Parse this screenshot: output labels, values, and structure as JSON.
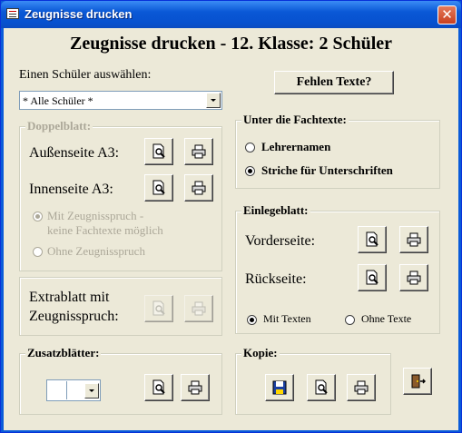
{
  "window": {
    "title": "Zeugnisse drucken",
    "close_glyph": "✕"
  },
  "heading": "Zeugnisse drucken - 12. Klasse: 2 Schüler",
  "student_select": {
    "label": "Einen Schüler auswählen:",
    "value": "* Alle Schüler *"
  },
  "missing_texts_button": "Fehlen Texte?",
  "doppelblatt": {
    "title": "Doppelblatt:",
    "aussen_label": "Außenseite A3:",
    "innen_label": "Innenseite A3:",
    "option_with_line1": "Mit Zeugnisspruch -",
    "option_with_line2": "keine Fachtexte möglich",
    "option_without": "Ohne Zeugnisspruch",
    "selected": "with"
  },
  "extrablatt": {
    "label_line1": "Extrablatt mit",
    "label_line2": "Zeugnisspruch:"
  },
  "fachtexte": {
    "title": "Unter die Fachtexte:",
    "option_lehrernamen": "Lehrernamen",
    "option_striche": "Striche für Unterschriften",
    "selected": "striche"
  },
  "einlegeblatt": {
    "title": "Einlegeblatt:",
    "vorderseite_label": "Vorderseite:",
    "rueckseite_label": "Rückseite:",
    "option_mit": "Mit Texten",
    "option_ohne": "Ohne Texte",
    "selected": "mit"
  },
  "zusatzblaetter": {
    "title": "Zusatzblätter:",
    "value": ""
  },
  "kopie": {
    "title": "Kopie:"
  },
  "icons": {
    "preview": "magnifier-page-icon",
    "print": "printer-icon",
    "save": "floppy-disk-icon",
    "exit": "exit-door-icon"
  }
}
